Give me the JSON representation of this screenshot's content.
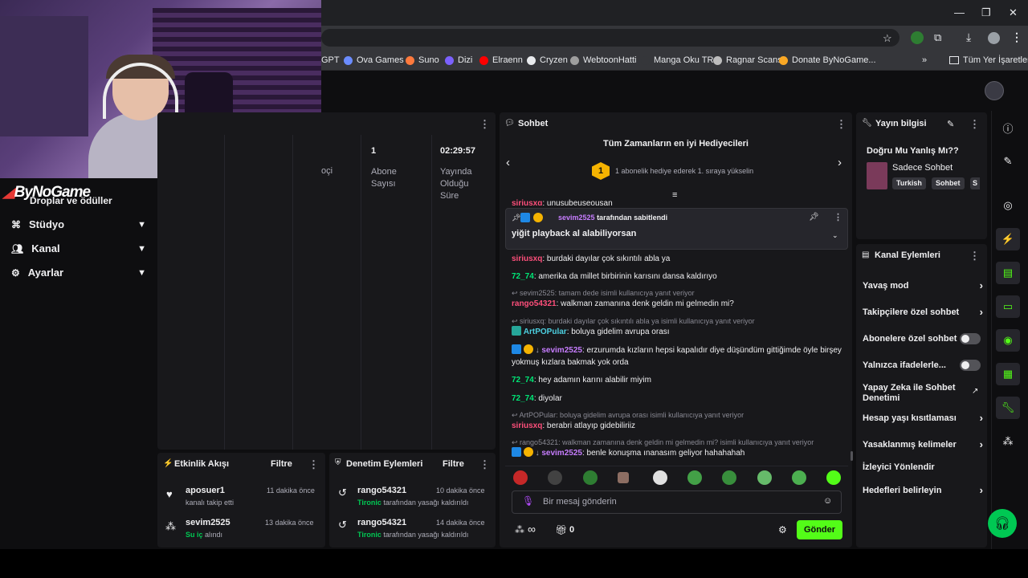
{
  "browser": {
    "bookmarks": [
      "GPT",
      "Ova Games",
      "Suno",
      "Dizi",
      "Elraenn",
      "Cryzen",
      "WebtoonHatti",
      "Manga Oku TR",
      "Ragnar Scans",
      "Donate ByNoGame..."
    ],
    "bookmarks_more": "»",
    "all_bookmarks": "Tüm Yer İşaretleri"
  },
  "overlay": {
    "logo_text": "ByNoGame"
  },
  "sidenav": {
    "partial_item": "Droplar ve ödüller",
    "items": [
      "Stüdyo",
      "Kanal",
      "Ayarlar"
    ]
  },
  "stats": {
    "partial_label": "oçi",
    "subs_value": "1",
    "subs_label": "Abone Sayısı",
    "uptime_value": "02:29:57",
    "uptime_label": "Yayında Olduğu Süre"
  },
  "activity": {
    "title": "Etkinlik Akışı",
    "filter": "Filtre",
    "items": [
      {
        "user": "aposuer1",
        "time": "11 dakika önce",
        "desc": "kanalı takip etti"
      },
      {
        "user": "sevim2525",
        "time": "13 dakika önce",
        "highlight": "Su iç",
        "desc": "alındı"
      }
    ]
  },
  "moderation": {
    "title": "Denetim Eylemleri",
    "filter": "Filtre",
    "items": [
      {
        "user": "rango54321",
        "time": "10 dakika önce",
        "actor": "Tironic",
        "desc": "tarafından yasağı kaldırıldı"
      },
      {
        "user": "rango54321",
        "time": "14 dakika önce",
        "actor": "Tironic",
        "desc": "tarafından yasağı kaldırıldı"
      }
    ]
  },
  "chat": {
    "title": "Sohbet",
    "gifters_title": "Tüm Zamanların en iyi Hediyecileri",
    "gifters_rank": "1",
    "gifters_desc": "1 abonelik hediye ederek 1. sıraya yükselin",
    "cut_line_user": "siriusxq",
    "cut_line_text": "unusubeuseousan",
    "pinned": {
      "user": "sevim2525",
      "suffix": "tarafından sabitlendi",
      "message": "yiğit playback al alabiliyorsan"
    },
    "messages": [
      {
        "user": "siriusxq",
        "color": "#ff4f7b",
        "text": "burdaki dayılar çok sıkıntılı abla ya"
      },
      {
        "user": "72_74",
        "color": "#00e676",
        "text": "amerika da millet birbirinin karısını dansa kaldırıyo"
      },
      {
        "reply": "sevim2525: tamam dede isimli kullanıcıya yanıt veriyor",
        "user": "rango54321",
        "color": "#ff4f7b",
        "text": "walkman zamanına denk geldin mi gelmedin mi?"
      },
      {
        "reply": "siriusxq: burdaki dayılar çok sıkıntılı abla ya isimli kullanıcıya yanıt veriyor",
        "user": "ArtPOPular",
        "color": "#4dd0e1",
        "text": "boluya gidelim avrupa orası"
      },
      {
        "user": "sevim2525",
        "color": "#c77dff",
        "text": "erzurumda kızların hepsi kapalıdır diye düşündüm gittiğimde öyle birşey yokmuş kızlara bakmak yok orda"
      },
      {
        "user": "72_74",
        "color": "#00e676",
        "text": "hey adamın karını alabilir miyim"
      },
      {
        "user": "72_74",
        "color": "#00e676",
        "text": "diyolar"
      },
      {
        "reply": "ArtPOPular: boluya gidelim avrupa orası isimli kullanıcıya yanıt veriyor",
        "user": "siriusxq",
        "color": "#ff4f7b",
        "text": "berabri atlayıp gidebiliriiz"
      },
      {
        "reply": "rango54321: walkman zamanına denk geldin mi gelmedin mi? isimli kullanıcıya yanıt veriyor",
        "user": "sevim2525",
        "color": "#c77dff",
        "text": "benle konuşma ınanasım geliyor hahahahah"
      }
    ],
    "input_placeholder": "Bir mesaj gönderin",
    "infinity": "∞",
    "gift_count": "0",
    "send_label": "Gönder"
  },
  "stream_info": {
    "title": "Yayın bilgisi",
    "stream_title": "Doğru Mu Yanlış Mı??",
    "category": "Sadece Sohbet",
    "tags": [
      "Turkish",
      "Sohbet",
      "S"
    ]
  },
  "channel_actions": {
    "title": "Kanal Eylemleri",
    "items": [
      {
        "label": "Yavaş mod",
        "kind": "arrow"
      },
      {
        "label": "Takipçilere özel sohbet",
        "kind": "arrow"
      },
      {
        "label": "Abonelere özel sohbet",
        "kind": "toggle"
      },
      {
        "label": "Yalnızca ifadelerle...",
        "kind": "toggle"
      },
      {
        "label": "Yapay Zeka ile Sohbet Denetimi",
        "kind": "external"
      },
      {
        "label": "Hesap yaşı kısıtlaması",
        "kind": "arrow"
      },
      {
        "label": "Yasaklanmış kelimeler",
        "kind": "arrow"
      },
      {
        "label": "İzleyici Yönlendir",
        "kind": "none"
      },
      {
        "label": "Hedefleri belirleyin",
        "kind": "arrow"
      }
    ]
  },
  "colors": {
    "accent": "#53fc18",
    "panel": "#18181b",
    "bg": "#0e0e10"
  }
}
